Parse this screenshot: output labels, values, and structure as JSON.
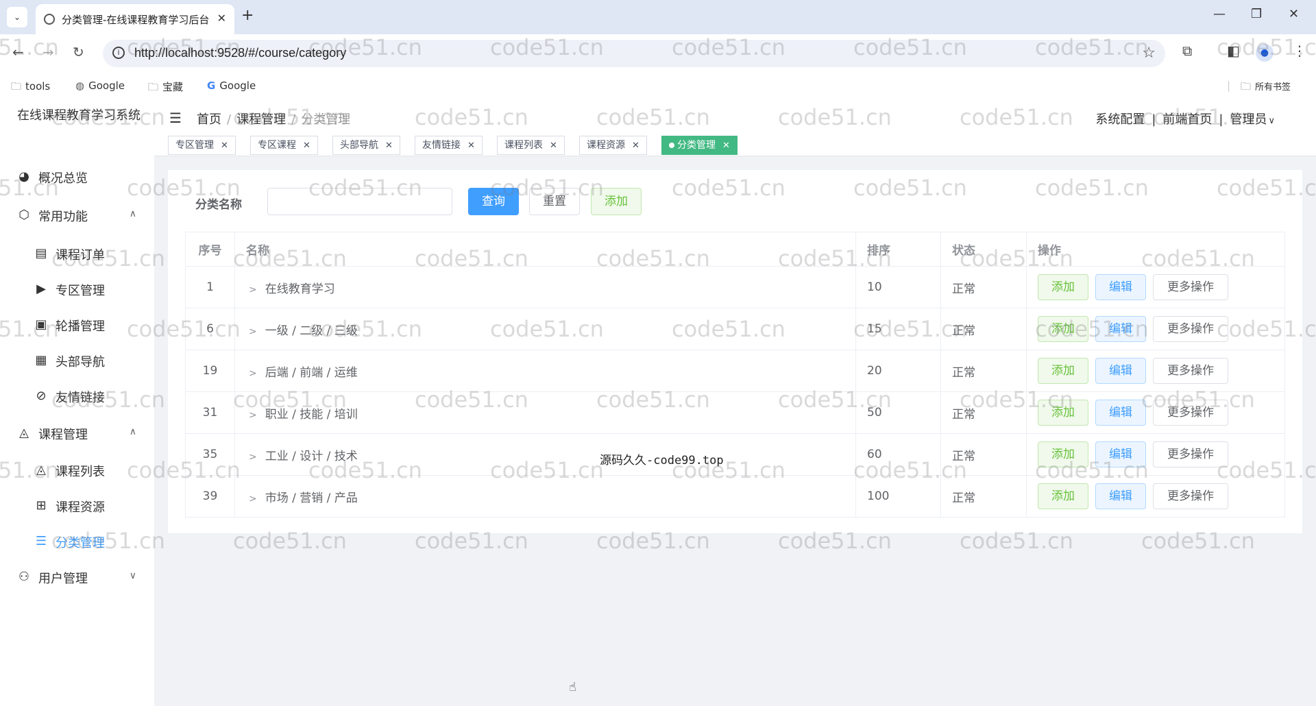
{
  "browser": {
    "tab_title": "分类管理-在线课程教育学习后台",
    "url": "http://localhost:9528/#/course/category",
    "bookmarks": [
      "tools",
      "Google",
      "宝藏",
      "Google"
    ],
    "all_bookmarks": "所有书签"
  },
  "app": {
    "logo": "在线课程教育学习系统",
    "breadcrumb": [
      "首页",
      "课程管理",
      "分类管理"
    ],
    "right_nav": [
      "系统配置",
      "前端首页",
      "管理员"
    ],
    "tags": [
      "专区管理",
      "专区课程",
      "头部导航",
      "友情链接",
      "课程列表",
      "课程资源",
      "分类管理"
    ],
    "menu": {
      "overview": "概况总览",
      "common": "常用功能",
      "orders": "课程订单",
      "zone": "专区管理",
      "carousel": "轮播管理",
      "topnav": "头部导航",
      "links": "友情链接",
      "course_mgmt": "课程管理",
      "course_list": "课程列表",
      "course_res": "课程资源",
      "category": "分类管理",
      "user_mgmt": "用户管理"
    },
    "search": {
      "label": "分类名称",
      "placeholder": "",
      "query": "查询",
      "reset": "重置",
      "add": "添加"
    },
    "table": {
      "headers": [
        "序号",
        "名称",
        "排序",
        "状态",
        "操作"
      ],
      "rows": [
        {
          "id": "1",
          "name": "在线教育学习",
          "sort": "10",
          "status": "正常"
        },
        {
          "id": "6",
          "name": "一级 / 二级 / 三级",
          "sort": "15",
          "status": "正常"
        },
        {
          "id": "19",
          "name": "后端 / 前端 / 运维",
          "sort": "20",
          "status": "正常"
        },
        {
          "id": "31",
          "name": "职业 / 技能 / 培训",
          "sort": "50",
          "status": "正常"
        },
        {
          "id": "35",
          "name": "工业 / 设计 / 技术",
          "sort": "60",
          "status": "正常"
        },
        {
          "id": "39",
          "name": "市场 / 营销 / 产品",
          "sort": "100",
          "status": "正常"
        }
      ],
      "actions": {
        "add": "添加",
        "edit": "编辑",
        "more": "更多操作"
      }
    },
    "overlay": "源码久久-code99.top",
    "watermark": "code51.cn"
  }
}
